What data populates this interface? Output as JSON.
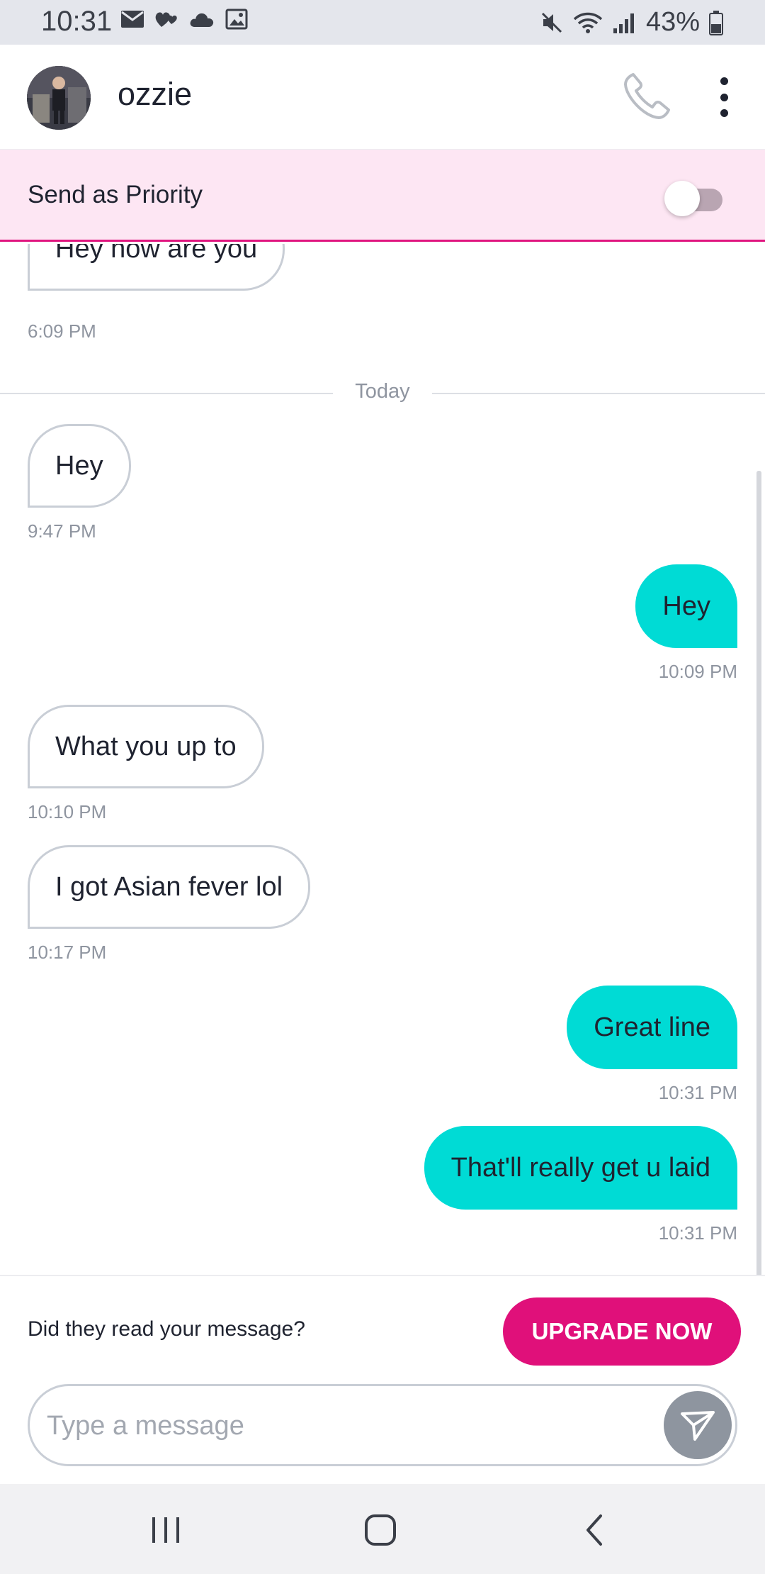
{
  "status_bar": {
    "time": "10:31",
    "battery": "43%",
    "left_icons": [
      "mail-icon",
      "hearts-icon",
      "cloud-icon",
      "image-icon"
    ],
    "right_icons": [
      "mute-icon",
      "wifi-icon",
      "signal-icon",
      "battery-icon"
    ]
  },
  "header": {
    "contact_name": "ozzie",
    "call_icon": "phone-icon",
    "menu_icon": "more-vertical-icon"
  },
  "priority": {
    "label": "Send as Priority",
    "enabled": false
  },
  "messages": [
    {
      "direction": "in",
      "text": "Hey how are you",
      "time": "6:09 PM"
    },
    {
      "divider": "Today"
    },
    {
      "direction": "in",
      "text": "Hey",
      "time": "9:47 PM"
    },
    {
      "direction": "out",
      "text": "Hey",
      "time": "10:09 PM"
    },
    {
      "direction": "in",
      "text": "What you up to",
      "time": "10:10 PM"
    },
    {
      "direction": "in",
      "text": "I got Asian fever lol",
      "time": "10:17 PM"
    },
    {
      "direction": "out",
      "text": "Great line",
      "time": "10:31 PM"
    },
    {
      "direction": "out",
      "text": "That'll really get u laid",
      "time": "10:31 PM"
    }
  ],
  "upgrade": {
    "prompt": "Did they read your message?",
    "button": "UPGRADE NOW"
  },
  "composer": {
    "placeholder": "Type a message",
    "value": "",
    "send_icon": "send-icon"
  },
  "nav": {
    "recents_icon": "recents-icon",
    "home_icon": "home-icon",
    "back_icon": "back-icon"
  },
  "colors": {
    "accent": "#e0107a",
    "outgoing_bubble": "#00dbd5",
    "priority_bg": "#fde6f3"
  }
}
